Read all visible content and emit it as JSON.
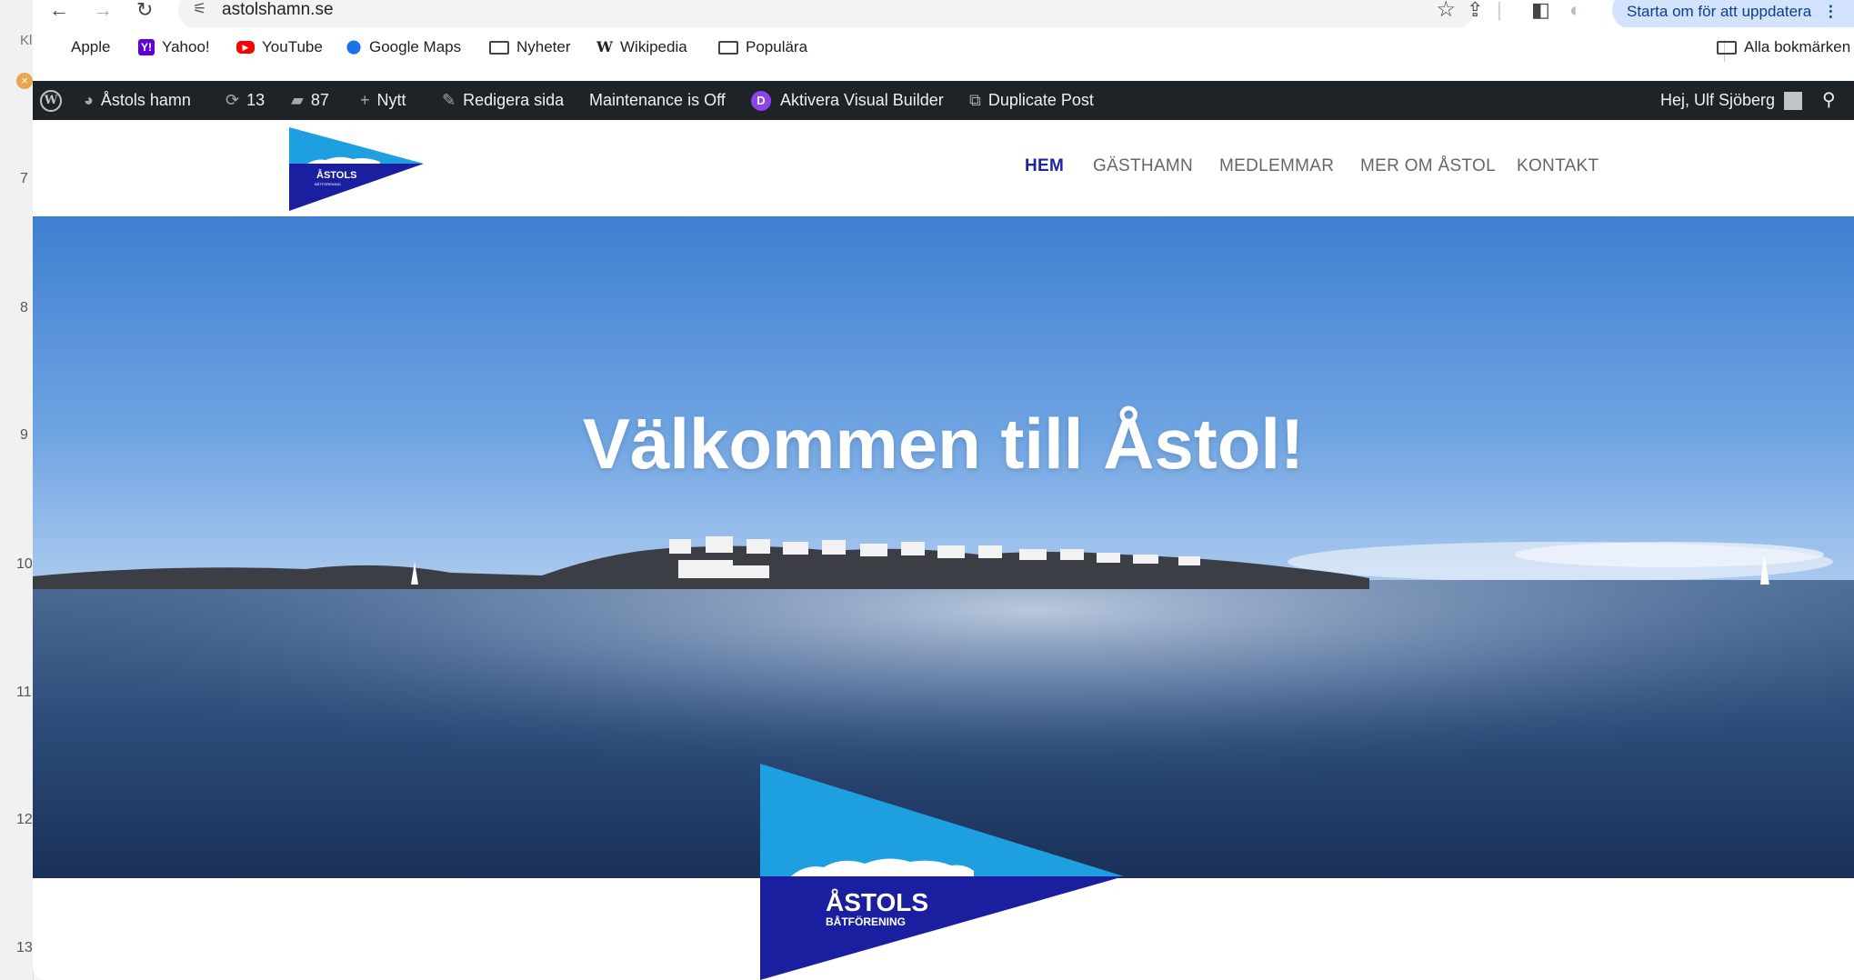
{
  "browser": {
    "url": "astolshamn.se",
    "update_button": "Starta om för att uppdatera",
    "tab_stub": "Kl"
  },
  "bookmarks": [
    {
      "label": "Apple",
      "icon": "apple-icon"
    },
    {
      "label": "Yahoo!",
      "icon": "yahoo-icon"
    },
    {
      "label": "YouTube",
      "icon": "youtube-icon"
    },
    {
      "label": "Google Maps",
      "icon": "google-maps-icon"
    },
    {
      "label": "Nyheter",
      "icon": "folder-icon"
    },
    {
      "label": "Wikipedia",
      "icon": "wikipedia-icon"
    },
    {
      "label": "Populära",
      "icon": "folder-icon"
    }
  ],
  "bookmarks_all": "Alla bokmärken",
  "adminbar": {
    "site_name": "Åstols hamn",
    "updates": "13",
    "comments": "87",
    "new": "Nytt",
    "edit_page": "Redigera sida",
    "maintenance": "Maintenance is Off",
    "visual_builder": "Aktivera Visual Builder",
    "duplicate": "Duplicate Post",
    "greeting": "Hej, Ulf Sjöberg"
  },
  "menu": [
    {
      "label": "HEM",
      "active": true
    },
    {
      "label": "GÄSTHAMN",
      "active": false
    },
    {
      "label": "MEDLEMMAR",
      "active": false
    },
    {
      "label": "MER OM ÅSTOL",
      "active": false
    },
    {
      "label": "KONTAKT",
      "active": false
    }
  ],
  "logo": {
    "line1": "ÅSTOLS",
    "line2": "BÅTFÖRENING"
  },
  "hero": {
    "title": "Välkommen till Åstol!"
  },
  "gutter_numbers": [
    "7",
    "8",
    "9",
    "10",
    "11",
    "12",
    "13"
  ],
  "colors": {
    "pennant_light": "#1e9fe0",
    "pennant_dark": "#1a1fa0",
    "wp_bar": "#1d2327",
    "menu_active": "#1e22a3"
  }
}
